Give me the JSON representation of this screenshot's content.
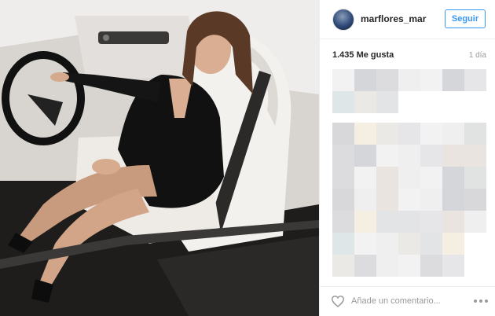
{
  "post": {
    "username": "marflores_mar",
    "follow_label": "Seguir",
    "likes": "1.435 Me gusta",
    "time": "1 día",
    "comment_placeholder": "Añade un comentario...",
    "icons": {
      "like": "heart-icon",
      "more": "more-options-icon",
      "avatar": "avatar"
    },
    "colors": {
      "follow": "#3897f0",
      "text": "#262626",
      "muted": "#999999",
      "border": "#efefef"
    }
  },
  "comments_blurred": true
}
